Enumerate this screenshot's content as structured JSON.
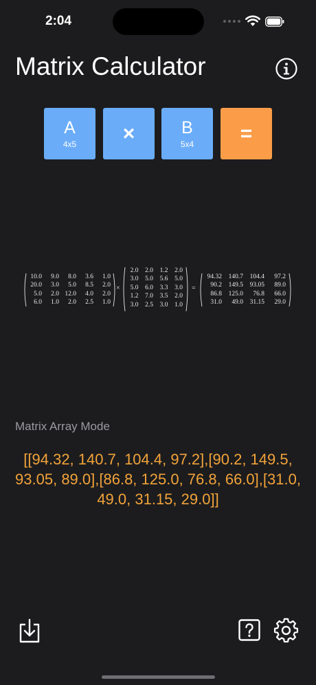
{
  "status_bar": {
    "time": "2:04"
  },
  "header": {
    "title": "Matrix Calculator",
    "info_icon": "info-circle-icon"
  },
  "operations": {
    "matrix_a": {
      "label": "A",
      "dimensions": "4x5"
    },
    "operator": {
      "label": "×"
    },
    "matrix_b": {
      "label": "B",
      "dimensions": "5x4"
    },
    "equals": {
      "label": "="
    }
  },
  "equation": {
    "multiply_symbol": "×",
    "equals_symbol": "=",
    "matrix_a": [
      [
        "10.0",
        "9.0",
        "8.0",
        "3.6",
        "1.0"
      ],
      [
        "20.0",
        "3.0",
        "5.0",
        "8.5",
        "2.0"
      ],
      [
        "5.0",
        "2.0",
        "12.0",
        "4.0",
        "2.0"
      ],
      [
        "6.0",
        "1.0",
        "2.0",
        "2.5",
        "1.0"
      ]
    ],
    "matrix_b": [
      [
        "2.0",
        "2.0",
        "1.2",
        "2.0"
      ],
      [
        "3.0",
        "5.0",
        "5.6",
        "5.0"
      ],
      [
        "5.0",
        "6.0",
        "3.3",
        "3.0"
      ],
      [
        "1.2",
        "7.0",
        "3.5",
        "2.0"
      ],
      [
        "3.0",
        "2.5",
        "3.0",
        "1.0"
      ]
    ],
    "result": [
      [
        "94.32",
        "140.7",
        "104.4",
        "97.2"
      ],
      [
        "90.2",
        "149.5",
        "93.05",
        "89.0"
      ],
      [
        "86.8",
        "125.0",
        "76.8",
        "66.0"
      ],
      [
        "31.0",
        "49.0",
        "31.15",
        "29.0"
      ]
    ]
  },
  "array_mode": {
    "label": "Matrix Array Mode",
    "value": "[[94.32, 140.7, 104.4, 97.2],[90.2, 149.5, 93.05, 89.0],[86.8, 125.0, 76.8, 66.0],[31.0, 49.0, 31.15, 29.0]]"
  },
  "toolbar": {
    "export_icon": "tray-download-icon",
    "help_icon": "question-square-icon",
    "settings_icon": "gear-icon"
  },
  "colors": {
    "background": "#1c1c1e",
    "matrix_button": "#6aacf8",
    "equals_button": "#fb9d48",
    "result_text": "#f2a33a",
    "label_text": "#9b9ba0"
  }
}
